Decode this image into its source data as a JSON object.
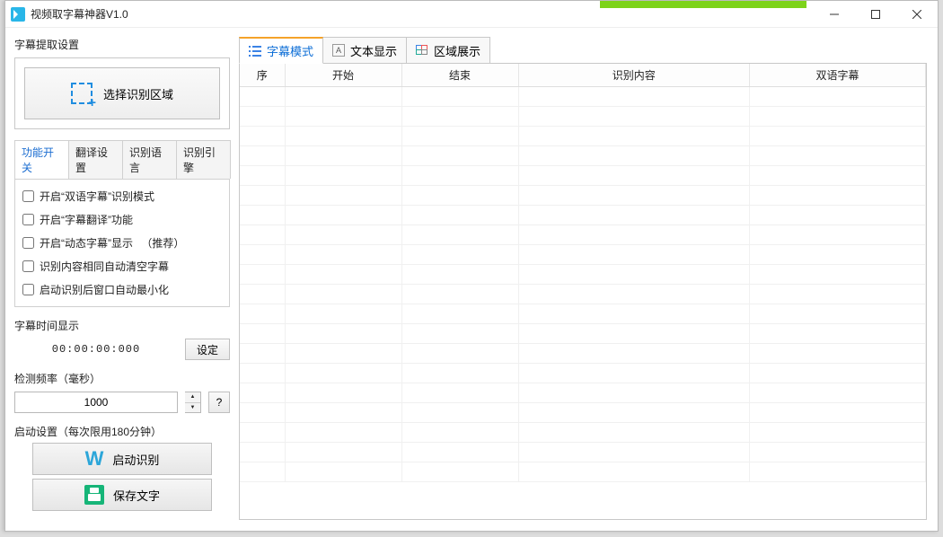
{
  "window": {
    "title": "视频取字幕神器V1.0"
  },
  "left": {
    "extract_label": "字幕提取设置",
    "select_area_btn": "选择识别区域",
    "tabs": [
      "功能开关",
      "翻译设置",
      "识别语言",
      "识别引擎"
    ],
    "checkboxes": [
      "开启“双语字幕”识别模式",
      "开启“字幕翻译”功能",
      "开启“动态字幕”显示 　（推荐）",
      "识别内容相同自动清空字幕",
      "启动识别后窗口自动最小化"
    ],
    "time_label": "字幕时间显示",
    "time_value": "00:00:00:000",
    "time_btn": "设定",
    "freq_label": "检测频率（毫秒）",
    "freq_value": "1000",
    "help_btn": "?",
    "start_label": "启动设置（每次限用180分钟）",
    "start_btn": "启动识别",
    "save_btn": "保存文字"
  },
  "right": {
    "tabs": [
      "字幕模式",
      "文本显示",
      "区域展示"
    ],
    "columns": [
      "序",
      "开始",
      "结束",
      "识别内容",
      "双语字幕"
    ]
  }
}
